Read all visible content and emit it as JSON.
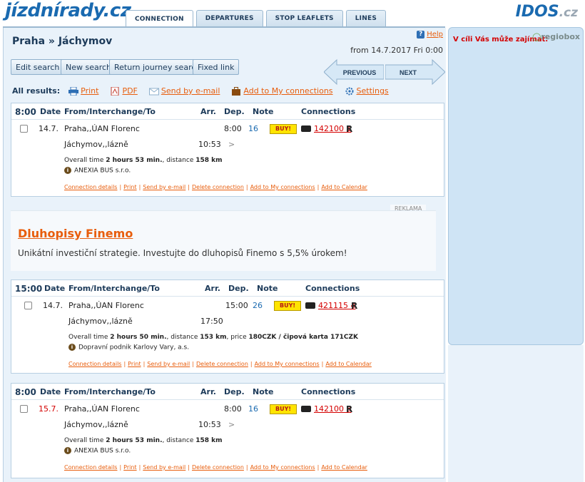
{
  "logo": "jízdnírady.cz",
  "idos": {
    "main": "IDOS",
    "suffix": ".cz"
  },
  "tabs": [
    "CONNECTION",
    "DEPARTURES",
    "STOP LEAFLETS",
    "LINES"
  ],
  "header": {
    "title": "Praha » Jáchymov",
    "help": "Help",
    "from_date": "from 14.7.2017 Fri 0:00"
  },
  "buttons": {
    "edit": "Edit search",
    "new": "New search",
    "return": "Return journey search",
    "fixed": "Fixed link",
    "previous": "PREVIOUS",
    "next": "NEXT"
  },
  "all_results": {
    "label": "All results:",
    "print": "Print",
    "pdf": "PDF",
    "email": "Send by e-mail",
    "add_my": "Add to My connections",
    "settings": "Settings"
  },
  "columns": {
    "date": "Date",
    "from": "From/Interchange/To",
    "arr": "Arr.",
    "dep": "Dep.",
    "note": "Note",
    "connections": "Connections"
  },
  "results": [
    {
      "time": "8:00",
      "date": "14.7.",
      "from": "Praha,,ÚAN Florenc",
      "dep": "8:00",
      "platform": "16",
      "buy": "BUY!",
      "conn": "142100 1",
      "conn_type": "R",
      "to": "Jáchymov,,lázně",
      "arr": "10:53",
      "arrow": ">",
      "summary_prefix": "Overall time ",
      "duration": "2 hours 53 min.",
      "summary_mid": ", distance ",
      "distance": "158 km",
      "summary_price": "",
      "carrier": "ANEXIA BUS s.r.o."
    },
    {
      "time": "15:00",
      "date": "14.7.",
      "from": "Praha,,ÚAN Florenc",
      "dep": "15:00",
      "platform": "26",
      "buy": "BUY!",
      "conn": "421115 4",
      "conn_type": "R",
      "to": "Jáchymov,,lázně",
      "arr": "17:50",
      "arrow": "",
      "summary_prefix": "Overall time ",
      "duration": "2 hours 50 min.",
      "summary_mid": ", distance ",
      "distance": "153 km",
      "summary_price_label": ", price ",
      "summary_price": "180CZK / čipová karta 171CZK",
      "carrier": "Dopravní podnik Karlovy Vary, a.s."
    },
    {
      "time": "8:00",
      "date": "15.7.",
      "from": "Praha,,ÚAN Florenc",
      "dep": "8:00",
      "platform": "16",
      "buy": "BUY!",
      "conn": "142100 3",
      "conn_type": "R",
      "to": "Jáchymov,,lázně",
      "arr": "10:53",
      "arrow": ">",
      "summary_prefix": "Overall time ",
      "duration": "2 hours 53 min.",
      "summary_mid": ", distance ",
      "distance": "158 km",
      "summary_price": "",
      "carrier": "ANEXIA BUS s.r.o."
    }
  ],
  "row_links": [
    "Connection details",
    "Print",
    "Send by e-mail",
    "Delete connection",
    "Add to My connections",
    "Add to Calendar"
  ],
  "ad": {
    "label": "REKLAMA",
    "title": "Dluhopisy Finemo",
    "text": "Unikátní investiční strategie. Investujte do dluhopisů Finemo s 5,5% úrokem!"
  },
  "side": {
    "title": "V cíli Vás může zajímat:",
    "brand": "regiobox"
  },
  "colors": {
    "accent": "#1a6ab0",
    "link": "#e85d0c",
    "red": "#d40000",
    "panel": "#e9f2fa"
  }
}
